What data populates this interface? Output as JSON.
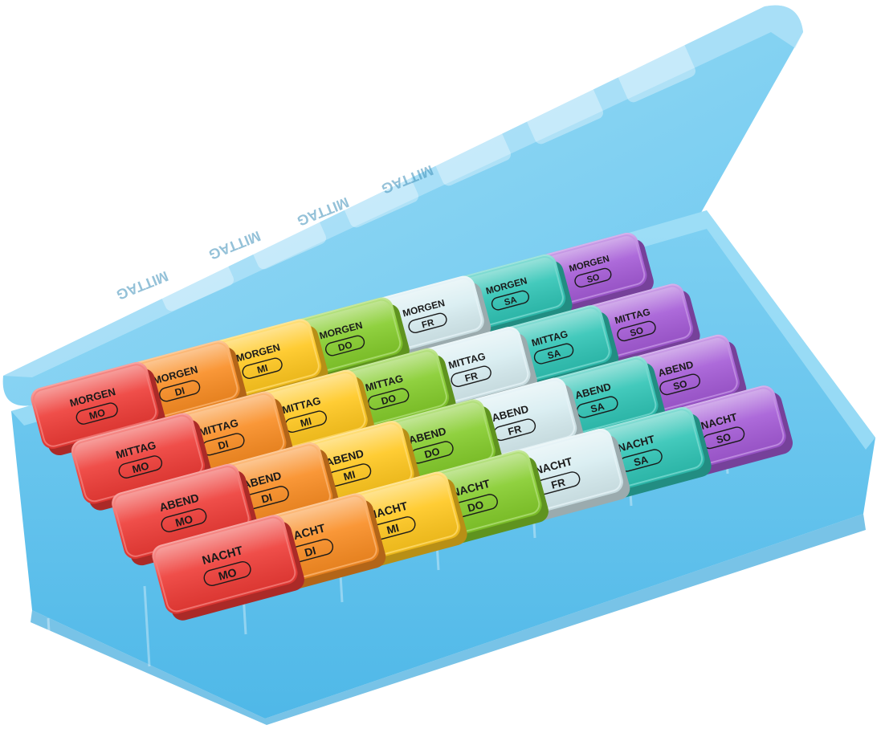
{
  "image": {
    "subject": "pill-organizer-icon",
    "case_color": "#5cc3ee",
    "lid_text_mirrored": [
      "MITTAG",
      "MITTAG",
      "MITTAG",
      "MITTAG"
    ]
  },
  "days": [
    {
      "day": "MO",
      "color": "#ee3b36"
    },
    {
      "day": "DI",
      "color": "#f98c22"
    },
    {
      "day": "MI",
      "color": "#ffc71e"
    },
    {
      "day": "DO",
      "color": "#84cc2b"
    },
    {
      "day": "FR",
      "color": "#d7edf1"
    },
    {
      "day": "SA",
      "color": "#2fc4b5"
    },
    {
      "day": "SO",
      "color": "#a45ad6"
    }
  ],
  "slots": [
    "MORGEN",
    "MITTAG",
    "ABEND",
    "NACHT"
  ]
}
